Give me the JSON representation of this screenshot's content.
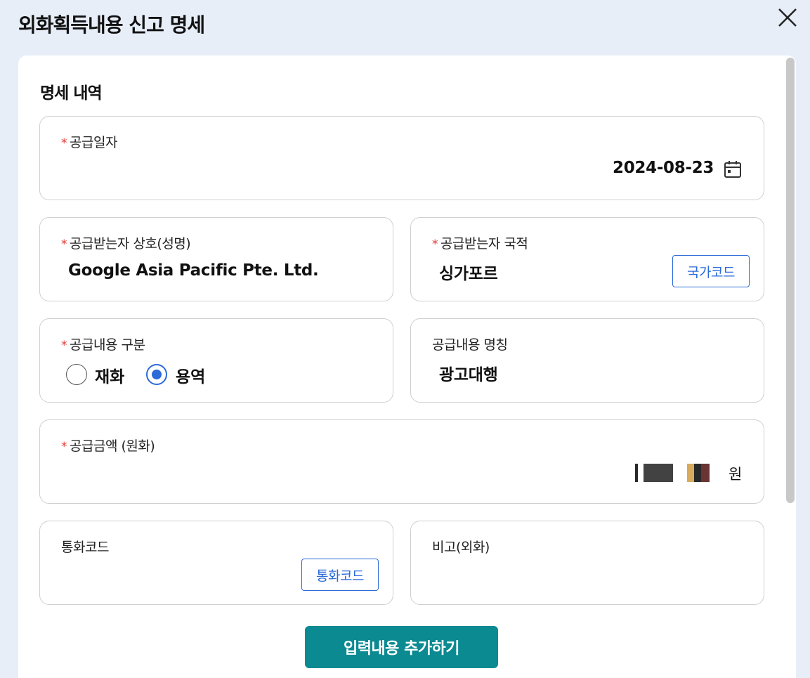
{
  "modal": {
    "title": "외화획득내용 신고 명세",
    "close_icon": "close-icon"
  },
  "section": {
    "title": "명세 내역"
  },
  "supply_date": {
    "label": "공급일자",
    "value": "2024-08-23",
    "icon": "calendar-icon"
  },
  "recipient_name": {
    "label": "공급받는자 상호(성명)",
    "value": "Google Asia Pacific Pte. Ltd."
  },
  "recipient_country": {
    "label": "공급받는자 국적",
    "value": "싱가포르",
    "button": "국가코드"
  },
  "supply_type": {
    "label": "공급내용 구분",
    "options": [
      "재화",
      "용역"
    ],
    "selected": "용역"
  },
  "supply_name": {
    "label": "공급내용 명칭",
    "value": "광고대행"
  },
  "supply_amount": {
    "label": "공급금액 (원화)",
    "unit": "원"
  },
  "currency_code": {
    "label": "통화코드",
    "button": "통화코드"
  },
  "remarks": {
    "label": "비고(외화)"
  },
  "actions": {
    "submit": "입력내용 추가하기"
  },
  "colors": {
    "accent": "#2b6ad8",
    "primary": "#0b8a92",
    "required": "#e53935"
  }
}
